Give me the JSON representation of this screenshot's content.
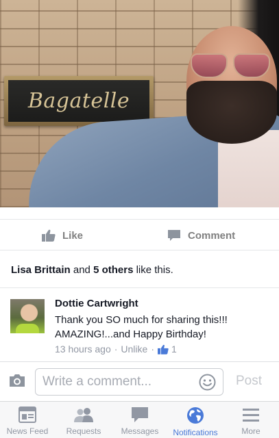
{
  "photo": {
    "sign_text": "Bagatelle"
  },
  "actions": {
    "like_label": "Like",
    "comment_label": "Comment"
  },
  "likes": {
    "name": "Lisa Brittain",
    "connector": "and",
    "others": "5 others",
    "suffix": "like this."
  },
  "comment": {
    "author": "Dottie Cartwright",
    "text": "Thank you SO much for sharing this!!! AMAZING!...and Happy Birthday!",
    "time": "13 hours ago",
    "unlike_label": "Unlike",
    "like_count": "1",
    "separator": "·"
  },
  "composer": {
    "placeholder": "Write a comment...",
    "value": "",
    "post_label": "Post"
  },
  "tabbar": {
    "active_tab": "notifications",
    "tabs": [
      {
        "id": "news-feed",
        "label": "News Feed"
      },
      {
        "id": "requests",
        "label": "Requests"
      },
      {
        "id": "messages",
        "label": "Messages"
      },
      {
        "id": "notifications",
        "label": "Notifications"
      },
      {
        "id": "more",
        "label": "More"
      }
    ]
  },
  "colors": {
    "accent": "#4a7ad8",
    "muted": "#9197a3",
    "text": "#141823"
  }
}
